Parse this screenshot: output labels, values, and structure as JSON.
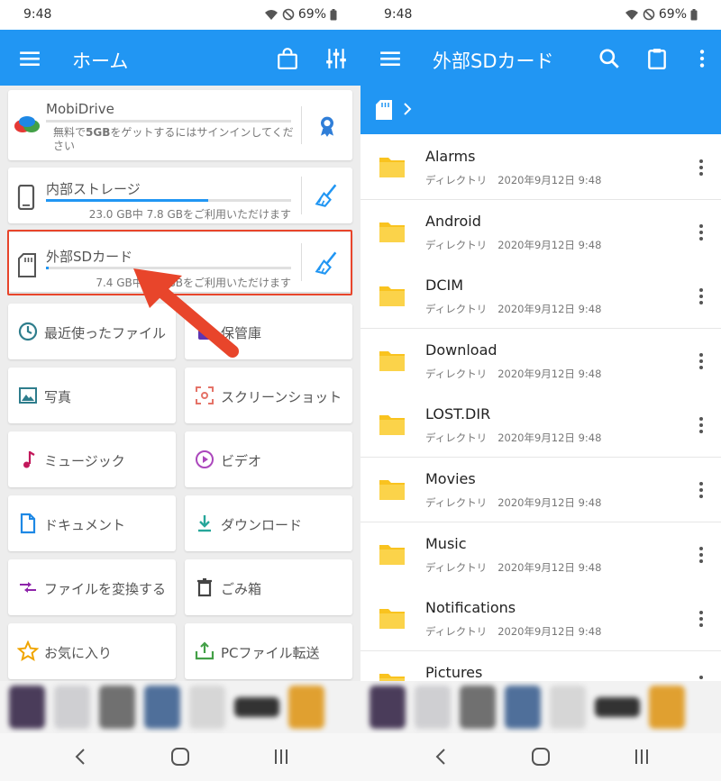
{
  "status": {
    "time": "9:48",
    "battery": "69%"
  },
  "left": {
    "title": "ホーム",
    "mobidrive": {
      "title": "MobiDrive",
      "promo_prefix": "無料で",
      "promo_bold": "5GB",
      "promo_suffix": "をゲットするにはサインインしてください"
    },
    "internal": {
      "title": "内部ストレージ",
      "summary": "23.0 GB中 7.8 GBをご利用いただけます",
      "used_fraction": 0.66
    },
    "sdcard": {
      "title": "外部SDカード",
      "summary": "7.4 GB中 7.4 GBをご利用いただけます",
      "used_fraction": 0.01
    },
    "tiles": [
      {
        "label": "最近使ったファイル",
        "icon": "clock-icon",
        "color": "#2e7d8c"
      },
      {
        "label": "保管庫",
        "icon": "lock-icon",
        "color": "#5e35b1"
      },
      {
        "label": "写真",
        "icon": "image-icon",
        "color": "#2e7d8c"
      },
      {
        "label": "スクリーンショット",
        "icon": "screenshot-icon",
        "color": "#e57368"
      },
      {
        "label": "ミュージック",
        "icon": "music-icon",
        "color": "#c2185b"
      },
      {
        "label": "ビデオ",
        "icon": "play-icon",
        "color": "#ab47bc"
      },
      {
        "label": "ドキュメント",
        "icon": "document-icon",
        "color": "#1e88e5"
      },
      {
        "label": "ダウンロード",
        "icon": "download-icon",
        "color": "#26a69a"
      },
      {
        "label": "ファイルを変換する",
        "icon": "convert-icon",
        "color": "#8e24aa"
      },
      {
        "label": "ごみ箱",
        "icon": "trash-icon",
        "color": "#444444"
      },
      {
        "label": "お気に入り",
        "icon": "star-icon",
        "color": "#f0a500"
      },
      {
        "label": "PCファイル転送",
        "icon": "pc-transfer-icon",
        "color": "#43a047"
      }
    ]
  },
  "right": {
    "title": "外部SDカード",
    "folders": [
      {
        "name": "Alarms",
        "type": "ディレクトリ",
        "date": "2020年9月12日 9:48"
      },
      {
        "name": "Android",
        "type": "ディレクトリ",
        "date": "2020年9月12日 9:48"
      },
      {
        "name": "DCIM",
        "type": "ディレクトリ",
        "date": "2020年9月12日 9:48"
      },
      {
        "name": "Download",
        "type": "ディレクトリ",
        "date": "2020年9月12日 9:48"
      },
      {
        "name": "LOST.DIR",
        "type": "ディレクトリ",
        "date": "2020年9月12日 9:48"
      },
      {
        "name": "Movies",
        "type": "ディレクトリ",
        "date": "2020年9月12日 9:48"
      },
      {
        "name": "Music",
        "type": "ディレクトリ",
        "date": "2020年9月12日 9:48"
      },
      {
        "name": "Notifications",
        "type": "ディレクトリ",
        "date": "2020年9月12日 9:48"
      },
      {
        "name": "Pictures",
        "type": "",
        "date": ""
      }
    ]
  },
  "colors": {
    "accent": "#2196f3",
    "folder": "#f9c31f",
    "highlight": "#e8452b"
  }
}
